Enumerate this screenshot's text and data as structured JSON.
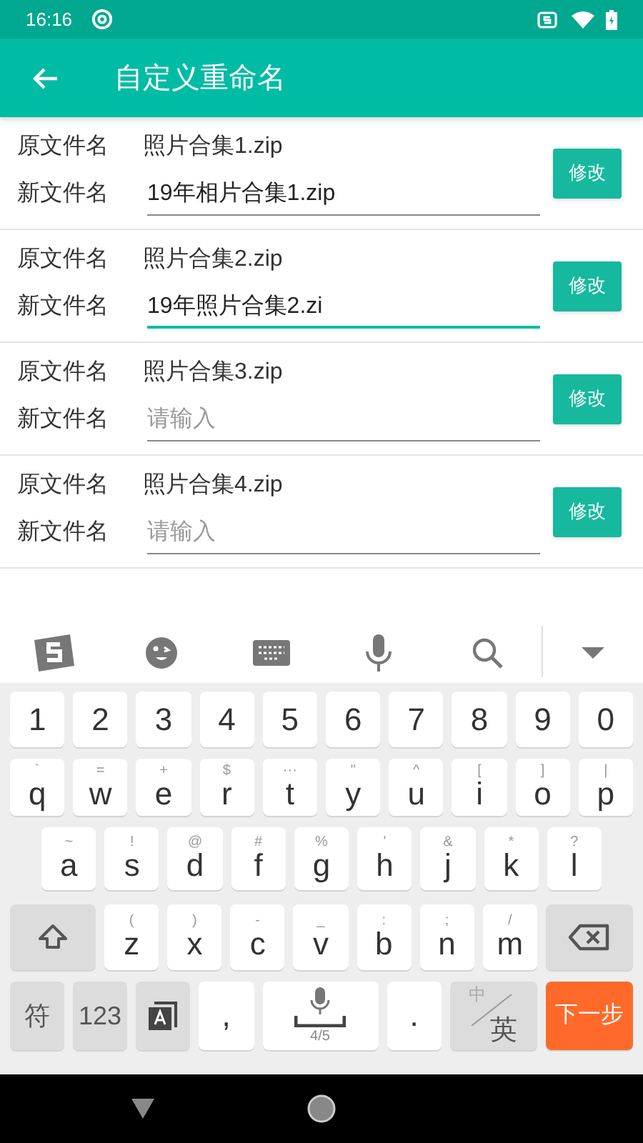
{
  "status_bar": {
    "time": "16:16"
  },
  "app_bar": {
    "title": "自定义重命名"
  },
  "rows": [
    {
      "original_label": "原文件名",
      "original": "照片合集1.zip",
      "new_label": "新文件名",
      "value": "19年相片合集1.zip",
      "focused": false,
      "button": "修改"
    },
    {
      "original_label": "原文件名",
      "original": "照片合集2.zip",
      "new_label": "新文件名",
      "value": "19年照片合集2.zi",
      "focused": true,
      "button": "修改"
    },
    {
      "original_label": "原文件名",
      "original": "照片合集3.zip",
      "new_label": "新文件名",
      "placeholder": "请输入",
      "focused": false,
      "button": "修改"
    },
    {
      "original_label": "原文件名",
      "original": "照片合集4.zip",
      "new_label": "新文件名",
      "placeholder": "请输入",
      "focused": false,
      "button": "修改"
    }
  ],
  "keyboard": {
    "rows": [
      {
        "keys": [
          {
            "kind": "key",
            "label": "1"
          },
          {
            "kind": "key",
            "label": "2"
          },
          {
            "kind": "key",
            "label": "3"
          },
          {
            "kind": "key",
            "label": "4"
          },
          {
            "kind": "key",
            "label": "5"
          },
          {
            "kind": "key",
            "label": "6"
          },
          {
            "kind": "key",
            "label": "7"
          },
          {
            "kind": "key",
            "label": "8"
          },
          {
            "kind": "key",
            "label": "9"
          },
          {
            "kind": "key",
            "label": "0"
          }
        ]
      },
      {
        "keys": [
          {
            "kind": "key",
            "label": "q",
            "hint": "`"
          },
          {
            "kind": "key",
            "label": "w",
            "hint": "="
          },
          {
            "kind": "key",
            "label": "e",
            "hint": "+"
          },
          {
            "kind": "key",
            "label": "r",
            "hint": "$"
          },
          {
            "kind": "key",
            "label": "t",
            "hint": "···"
          },
          {
            "kind": "key",
            "label": "y",
            "hint": "\""
          },
          {
            "kind": "key",
            "label": "u",
            "hint": "^"
          },
          {
            "kind": "key",
            "label": "i",
            "hint": "["
          },
          {
            "kind": "key",
            "label": "o",
            "hint": "]"
          },
          {
            "kind": "key",
            "label": "p",
            "hint": "|"
          }
        ]
      },
      {
        "keys": [
          {
            "kind": "key",
            "label": "a",
            "hint": "~"
          },
          {
            "kind": "key",
            "label": "s",
            "hint": "!"
          },
          {
            "kind": "key",
            "label": "d",
            "hint": "@"
          },
          {
            "kind": "key",
            "label": "f",
            "hint": "#"
          },
          {
            "kind": "key",
            "label": "g",
            "hint": "%"
          },
          {
            "kind": "key",
            "label": "h",
            "hint": "'"
          },
          {
            "kind": "key",
            "label": "j",
            "hint": "&"
          },
          {
            "kind": "key",
            "label": "k",
            "hint": "*"
          },
          {
            "kind": "key",
            "label": "l",
            "hint": "?"
          }
        ]
      },
      {
        "keys": [
          {
            "kind": "shift"
          },
          {
            "kind": "key",
            "label": "z",
            "hint": "("
          },
          {
            "kind": "key",
            "label": "x",
            "hint": ")"
          },
          {
            "kind": "key",
            "label": "c",
            "hint": "-"
          },
          {
            "kind": "key",
            "label": "v",
            "hint": "_"
          },
          {
            "kind": "key",
            "label": "b",
            "hint": ":"
          },
          {
            "kind": "key",
            "label": "n",
            "hint": ";"
          },
          {
            "kind": "key",
            "label": "m",
            "hint": "/"
          },
          {
            "kind": "backspace"
          }
        ]
      },
      {
        "keys": [
          {
            "kind": "function",
            "label": "符"
          },
          {
            "kind": "function",
            "label": "123"
          },
          {
            "kind": "layout"
          },
          {
            "kind": "key",
            "label": ","
          },
          {
            "kind": "space",
            "sub": "4/5"
          },
          {
            "kind": "key",
            "label": "."
          },
          {
            "kind": "lang",
            "small": "中",
            "label": "英"
          },
          {
            "kind": "enter",
            "label": "下一步"
          }
        ]
      }
    ]
  }
}
